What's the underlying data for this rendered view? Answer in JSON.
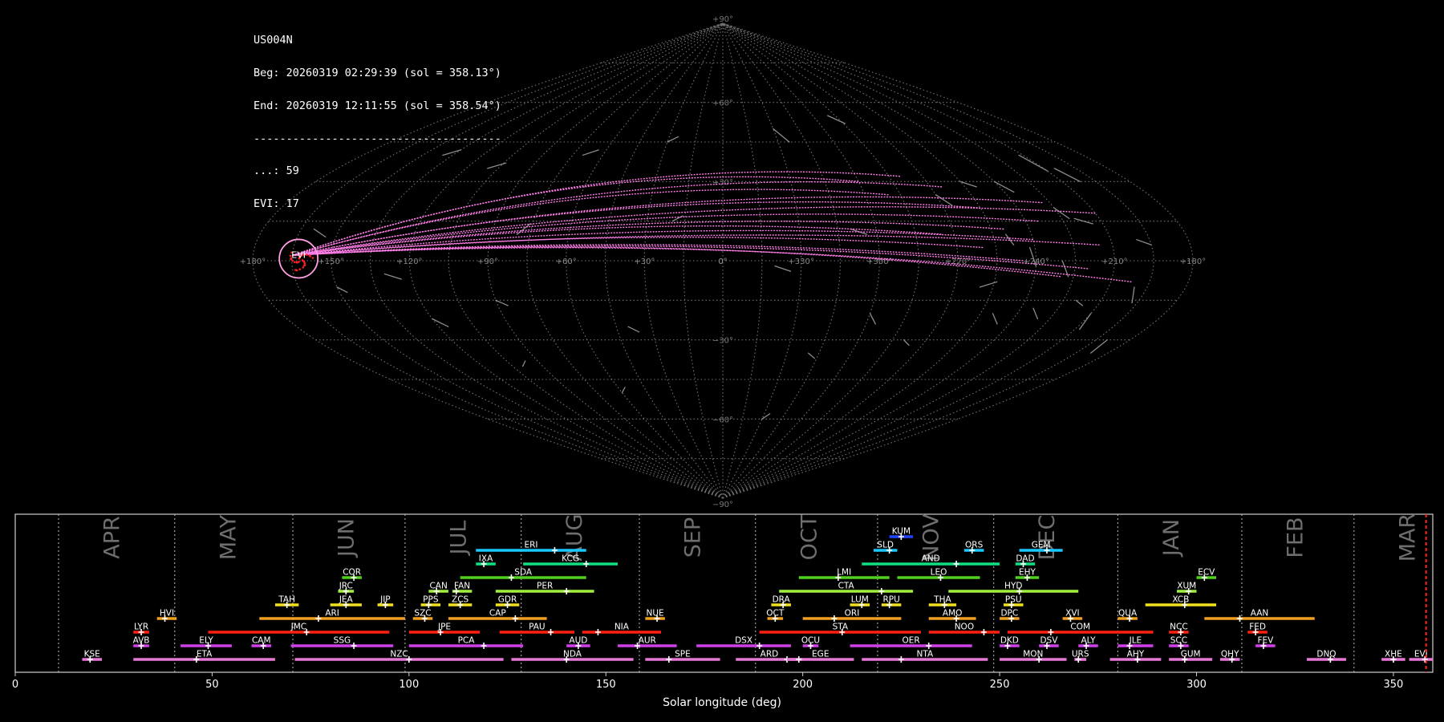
{
  "header": {
    "station": "US004N",
    "begin": "Beg: 20260319 02:29:39 (sol = 358.13°)",
    "end": "End: 20260319 12:11:55 (sol = 358.54°)",
    "separator": "--------------------------------------",
    "sporadic": "...: 59",
    "evi": "EVI: 17"
  },
  "colors": {
    "background": "#000000",
    "grid": "#9a9a9a",
    "meteor_sporadic": "#8c8c8c",
    "meteor_shower": "#ff7ee8",
    "radiant": "#ff2020",
    "radiant_ring": "#ff9ee0",
    "current_sol_line": "#ff2020"
  },
  "chart_data": [
    {
      "type": "scatter",
      "projection": "sinusoidal",
      "title": "",
      "lat_ticks": [
        "+90°",
        "+60°",
        "+30°",
        "0°",
        "−30°",
        "−60°",
        "−90°"
      ],
      "lat_tick_values": [
        90,
        60,
        30,
        0,
        -30,
        -60,
        -90
      ],
      "lon_ticks": [
        "+180°",
        "+150°",
        "+120°",
        "+90°",
        "+60°",
        "+30°",
        "0°",
        "+330°",
        "+300°",
        "+270°",
        "+240°",
        "+210°",
        "+180°"
      ],
      "radiant_label": "EVI",
      "radiant": {
        "lon": -165,
        "lat": 2
      },
      "grid": true,
      "sporadic_count": 59,
      "shower_count": 17
    },
    {
      "type": "bar",
      "title": "",
      "xlabel": "Solar longitude (deg)",
      "ylabel": "",
      "xlim": [
        0,
        360
      ],
      "xticks": [
        0,
        50,
        100,
        150,
        200,
        250,
        300,
        350
      ],
      "current_sol": 358.3,
      "months": [
        {
          "name": "APR",
          "pos": 11
        },
        {
          "name": "MAY",
          "pos": 40.5
        },
        {
          "name": "JUN",
          "pos": 70.5
        },
        {
          "name": "JUL",
          "pos": 99
        },
        {
          "name": "AUG",
          "pos": 128.5
        },
        {
          "name": "SEP",
          "pos": 158.5
        },
        {
          "name": "OCT",
          "pos": 188
        },
        {
          "name": "NOV",
          "pos": 219
        },
        {
          "name": "DEC",
          "pos": 248.5
        },
        {
          "name": "JAN",
          "pos": 280
        },
        {
          "name": "FEB",
          "pos": 311.5
        },
        {
          "name": "MAR",
          "pos": 340
        }
      ],
      "showers": [
        {
          "code": "KUM",
          "start": 222,
          "end": 228,
          "peak": 225,
          "row": 11,
          "color": "#2244ff"
        },
        {
          "code": "ERI",
          "start": 117,
          "end": 145,
          "peak": 137,
          "row": 10,
          "color": "#18c8ff"
        },
        {
          "code": "SLD",
          "start": 218,
          "end": 224,
          "peak": 222,
          "row": 10,
          "color": "#18c8ff"
        },
        {
          "code": "ORS",
          "start": 241,
          "end": 246,
          "peak": 243,
          "row": 10,
          "color": "#18c8ff"
        },
        {
          "code": "GEM",
          "start": 255,
          "end": 266,
          "peak": 262,
          "row": 10,
          "color": "#18c8ff"
        },
        {
          "code": "IXA",
          "start": 117,
          "end": 122,
          "peak": 119,
          "row": 9,
          "color": "#10e080"
        },
        {
          "code": "KCG",
          "start": 129,
          "end": 153,
          "peak": 145,
          "row": 9,
          "color": "#10e080"
        },
        {
          "code": "AND",
          "start": 215,
          "end": 250,
          "peak": 239,
          "row": 9,
          "color": "#10e080"
        },
        {
          "code": "DAD",
          "start": 254,
          "end": 259,
          "peak": 256,
          "row": 9,
          "color": "#10e080"
        },
        {
          "code": "COR",
          "start": 83,
          "end": 88,
          "peak": 86,
          "row": 8,
          "color": "#50d020"
        },
        {
          "code": "SDA",
          "start": 113,
          "end": 145,
          "peak": 126,
          "row": 8,
          "color": "#50d020"
        },
        {
          "code": "LMI",
          "start": 199,
          "end": 222,
          "peak": 209,
          "row": 8,
          "color": "#50d020"
        },
        {
          "code": "LEO",
          "start": 224,
          "end": 245,
          "peak": 235,
          "row": 8,
          "color": "#50d020"
        },
        {
          "code": "EHY",
          "start": 254,
          "end": 260,
          "peak": 257,
          "row": 8,
          "color": "#50d020"
        },
        {
          "code": "ECV",
          "start": 300,
          "end": 305,
          "peak": 302,
          "row": 8,
          "color": "#50d020"
        },
        {
          "code": "JRC",
          "start": 82,
          "end": 86,
          "peak": 84,
          "row": 7,
          "color": "#a0f040"
        },
        {
          "code": "CAN",
          "start": 105,
          "end": 110,
          "peak": 107,
          "row": 7,
          "color": "#a0f040"
        },
        {
          "code": "FAN",
          "start": 111,
          "end": 116,
          "peak": 112,
          "row": 7,
          "color": "#a0f040"
        },
        {
          "code": "PER",
          "start": 122,
          "end": 147,
          "peak": 140,
          "row": 7,
          "color": "#a0f040"
        },
        {
          "code": "CTA",
          "start": 194,
          "end": 228,
          "peak": 220,
          "row": 7,
          "color": "#a0f040"
        },
        {
          "code": "HYD",
          "start": 237,
          "end": 270,
          "peak": 255,
          "row": 7,
          "color": "#a0f040"
        },
        {
          "code": "XUM",
          "start": 295,
          "end": 300,
          "peak": 298,
          "row": 7,
          "color": "#a0f040"
        },
        {
          "code": "TAH",
          "start": 66,
          "end": 72,
          "peak": 69,
          "row": 6,
          "color": "#f0e020"
        },
        {
          "code": "JEA",
          "start": 80,
          "end": 88,
          "peak": 84,
          "row": 6,
          "color": "#f0e020"
        },
        {
          "code": "JIP",
          "start": 92,
          "end": 96,
          "peak": 94,
          "row": 6,
          "color": "#f0e020"
        },
        {
          "code": "PPS",
          "start": 103,
          "end": 108,
          "peak": 105,
          "row": 6,
          "color": "#f0e020"
        },
        {
          "code": "ZCS",
          "start": 110,
          "end": 116,
          "peak": 113,
          "row": 6,
          "color": "#f0e020"
        },
        {
          "code": "GDR",
          "start": 122,
          "end": 128,
          "peak": 125,
          "row": 6,
          "color": "#f0e020"
        },
        {
          "code": "DRA",
          "start": 192,
          "end": 197,
          "peak": 195,
          "row": 6,
          "color": "#f0e020"
        },
        {
          "code": "LUM",
          "start": 212,
          "end": 217,
          "peak": 215,
          "row": 6,
          "color": "#f0e020"
        },
        {
          "code": "RPU",
          "start": 220,
          "end": 225,
          "peak": 222,
          "row": 6,
          "color": "#f0e020"
        },
        {
          "code": "THA",
          "start": 232,
          "end": 239,
          "peak": 236,
          "row": 6,
          "color": "#f0e020"
        },
        {
          "code": "PSU",
          "start": 251,
          "end": 256,
          "peak": 253,
          "row": 6,
          "color": "#f0e020"
        },
        {
          "code": "XCB",
          "start": 287,
          "end": 305,
          "peak": 297,
          "row": 6,
          "color": "#f0e020"
        },
        {
          "code": "HVI",
          "start": 36,
          "end": 41,
          "peak": 38,
          "row": 5,
          "color": "#f0a020"
        },
        {
          "code": "ARI",
          "start": 62,
          "end": 99,
          "peak": 77,
          "row": 5,
          "color": "#f0a020"
        },
        {
          "code": "SZC",
          "start": 101,
          "end": 106,
          "peak": 104,
          "row": 5,
          "color": "#f0a020"
        },
        {
          "code": "CAP",
          "start": 110,
          "end": 135,
          "peak": 127,
          "row": 5,
          "color": "#f0a020"
        },
        {
          "code": "NUE",
          "start": 160,
          "end": 165,
          "peak": 163,
          "row": 5,
          "color": "#f0a020"
        },
        {
          "code": "OCT",
          "start": 191,
          "end": 195,
          "peak": 193,
          "row": 5,
          "color": "#f0a020"
        },
        {
          "code": "ORI",
          "start": 200,
          "end": 225,
          "peak": 208,
          "row": 5,
          "color": "#f0a020"
        },
        {
          "code": "AMO",
          "start": 232,
          "end": 244,
          "peak": 239,
          "row": 5,
          "color": "#f0a020"
        },
        {
          "code": "DPC",
          "start": 250,
          "end": 255,
          "peak": 253,
          "row": 5,
          "color": "#f0a020"
        },
        {
          "code": "XVI",
          "start": 266,
          "end": 271,
          "peak": 268,
          "row": 5,
          "color": "#f0a020"
        },
        {
          "code": "QUA",
          "start": 280,
          "end": 285,
          "peak": 283,
          "row": 5,
          "color": "#f0a020"
        },
        {
          "code": "AAN",
          "start": 302,
          "end": 330,
          "peak": 311,
          "row": 5,
          "color": "#f0a020"
        },
        {
          "code": "LYR",
          "start": 30,
          "end": 34,
          "peak": 32,
          "row": 4,
          "color": "#ff2010"
        },
        {
          "code": "JMC",
          "start": 49,
          "end": 95,
          "peak": 74,
          "row": 4,
          "color": "#ff2010"
        },
        {
          "code": "JPE",
          "start": 100,
          "end": 118,
          "peak": 108,
          "row": 4,
          "color": "#ff2010"
        },
        {
          "code": "PAU",
          "start": 123,
          "end": 142,
          "peak": 136,
          "row": 4,
          "color": "#ff2010"
        },
        {
          "code": "NIA",
          "start": 144,
          "end": 164,
          "peak": 148,
          "row": 4,
          "color": "#ff2010"
        },
        {
          "code": "STA",
          "start": 189,
          "end": 230,
          "peak": 210,
          "row": 4,
          "color": "#ff2010"
        },
        {
          "code": "NOO",
          "start": 232,
          "end": 250,
          "peak": 246,
          "row": 4,
          "color": "#ff2010"
        },
        {
          "code": "COM",
          "start": 252,
          "end": 289,
          "peak": 263,
          "row": 4,
          "color": "#ff2010"
        },
        {
          "code": "NCC",
          "start": 293,
          "end": 298,
          "peak": 296,
          "row": 4,
          "color": "#ff2010"
        },
        {
          "code": "FED",
          "start": 313,
          "end": 318,
          "peak": 315,
          "row": 4,
          "color": "#ff2010"
        },
        {
          "code": "AVB",
          "start": 30,
          "end": 34,
          "peak": 32,
          "row": 3,
          "color": "#d040e8"
        },
        {
          "code": "ELY",
          "start": 42,
          "end": 55,
          "peak": 49,
          "row": 3,
          "color": "#d040e8"
        },
        {
          "code": "CAM",
          "start": 60,
          "end": 65,
          "peak": 63,
          "row": 3,
          "color": "#d040e8"
        },
        {
          "code": "SSG",
          "start": 70,
          "end": 96,
          "peak": 86,
          "row": 3,
          "color": "#d040e8"
        },
        {
          "code": "PCA",
          "start": 100,
          "end": 129,
          "peak": 119,
          "row": 3,
          "color": "#d040e8"
        },
        {
          "code": "AUD",
          "start": 140,
          "end": 146,
          "peak": 143,
          "row": 3,
          "color": "#d040e8"
        },
        {
          "code": "AUR",
          "start": 153,
          "end": 168,
          "peak": 158,
          "row": 3,
          "color": "#d040e8"
        },
        {
          "code": "DSX",
          "start": 173,
          "end": 197,
          "peak": 189,
          "row": 3,
          "color": "#d040e8"
        },
        {
          "code": "OCU",
          "start": 200,
          "end": 204,
          "peak": 202,
          "row": 3,
          "color": "#d040e8"
        },
        {
          "code": "OER",
          "start": 212,
          "end": 243,
          "peak": 232,
          "row": 3,
          "color": "#d040e8"
        },
        {
          "code": "DKD",
          "start": 250,
          "end": 255,
          "peak": 252,
          "row": 3,
          "color": "#d040e8"
        },
        {
          "code": "DSV",
          "start": 260,
          "end": 265,
          "peak": 262,
          "row": 3,
          "color": "#d040e8"
        },
        {
          "code": "ALY",
          "start": 270,
          "end": 275,
          "peak": 272,
          "row": 3,
          "color": "#d040e8"
        },
        {
          "code": "JLE",
          "start": 280,
          "end": 289,
          "peak": 283,
          "row": 3,
          "color": "#d040e8"
        },
        {
          "code": "SCC",
          "start": 293,
          "end": 298,
          "peak": 296,
          "row": 3,
          "color": "#d040e8"
        },
        {
          "code": "FEV",
          "start": 315,
          "end": 320,
          "peak": 317,
          "row": 3,
          "color": "#d040e8"
        },
        {
          "code": "KSE",
          "start": 17,
          "end": 22,
          "peak": 19,
          "row": 2,
          "color": "#e878d8"
        },
        {
          "code": "ETA",
          "start": 30,
          "end": 66,
          "peak": 46,
          "row": 2,
          "color": "#e878d8"
        },
        {
          "code": "NZC",
          "start": 71,
          "end": 124,
          "peak": 100,
          "row": 2,
          "color": "#e878d8"
        },
        {
          "code": "NDA",
          "start": 126,
          "end": 157,
          "peak": 140,
          "row": 2,
          "color": "#e878d8"
        },
        {
          "code": "SPE",
          "start": 160,
          "end": 179,
          "peak": 166,
          "row": 2,
          "color": "#e878d8"
        },
        {
          "code": "ARD",
          "start": 183,
          "end": 200,
          "peak": 196,
          "row": 2,
          "color": "#e878d8"
        },
        {
          "code": "EGE",
          "start": 196,
          "end": 213,
          "peak": 199,
          "row": 2,
          "color": "#e878d8"
        },
        {
          "code": "NTA",
          "start": 215,
          "end": 247,
          "peak": 225,
          "row": 2,
          "color": "#e878d8"
        },
        {
          "code": "MON",
          "start": 250,
          "end": 267,
          "peak": 260,
          "row": 2,
          "color": "#e878d8"
        },
        {
          "code": "URS",
          "start": 269,
          "end": 272,
          "peak": 270,
          "row": 2,
          "color": "#e878d8"
        },
        {
          "code": "AHY",
          "start": 278,
          "end": 291,
          "peak": 285,
          "row": 2,
          "color": "#e878d8"
        },
        {
          "code": "GUM",
          "start": 293,
          "end": 304,
          "peak": 297,
          "row": 2,
          "color": "#e878d8"
        },
        {
          "code": "QHY",
          "start": 306,
          "end": 311,
          "peak": 309,
          "row": 2,
          "color": "#e878d8"
        },
        {
          "code": "DNQ",
          "start": 328,
          "end": 338,
          "peak": 334,
          "row": 2,
          "color": "#e878d8"
        },
        {
          "code": "XHE",
          "start": 347,
          "end": 353,
          "peak": 350,
          "row": 2,
          "color": "#e878d8"
        },
        {
          "code": "EVI",
          "start": 354,
          "end": 360,
          "peak": 358,
          "row": 2,
          "color": "#e878d8"
        }
      ]
    }
  ]
}
